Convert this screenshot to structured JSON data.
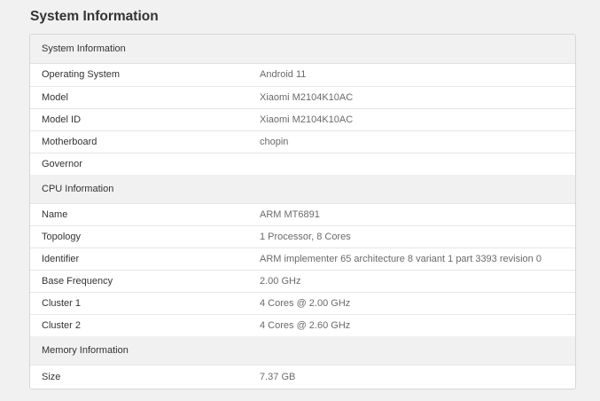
{
  "page_title": "System Information",
  "sections": [
    {
      "header": "System Information",
      "rows": [
        {
          "label": "Operating System",
          "value": "Android 11"
        },
        {
          "label": "Model",
          "value": "Xiaomi M2104K10AC"
        },
        {
          "label": "Model ID",
          "value": "Xiaomi M2104K10AC"
        },
        {
          "label": "Motherboard",
          "value": "chopin"
        },
        {
          "label": "Governor",
          "value": ""
        }
      ]
    },
    {
      "header": "CPU Information",
      "rows": [
        {
          "label": "Name",
          "value": "ARM MT6891"
        },
        {
          "label": "Topology",
          "value": "1 Processor, 8 Cores"
        },
        {
          "label": "Identifier",
          "value": "ARM implementer 65 architecture 8 variant 1 part 3393 revision 0"
        },
        {
          "label": "Base Frequency",
          "value": "2.00 GHz"
        },
        {
          "label": "Cluster 1",
          "value": "4 Cores @ 2.00 GHz"
        },
        {
          "label": "Cluster 2",
          "value": "4 Cores @ 2.60 GHz"
        }
      ]
    },
    {
      "header": "Memory Information",
      "rows": [
        {
          "label": "Size",
          "value": "7.37 GB"
        }
      ]
    }
  ]
}
